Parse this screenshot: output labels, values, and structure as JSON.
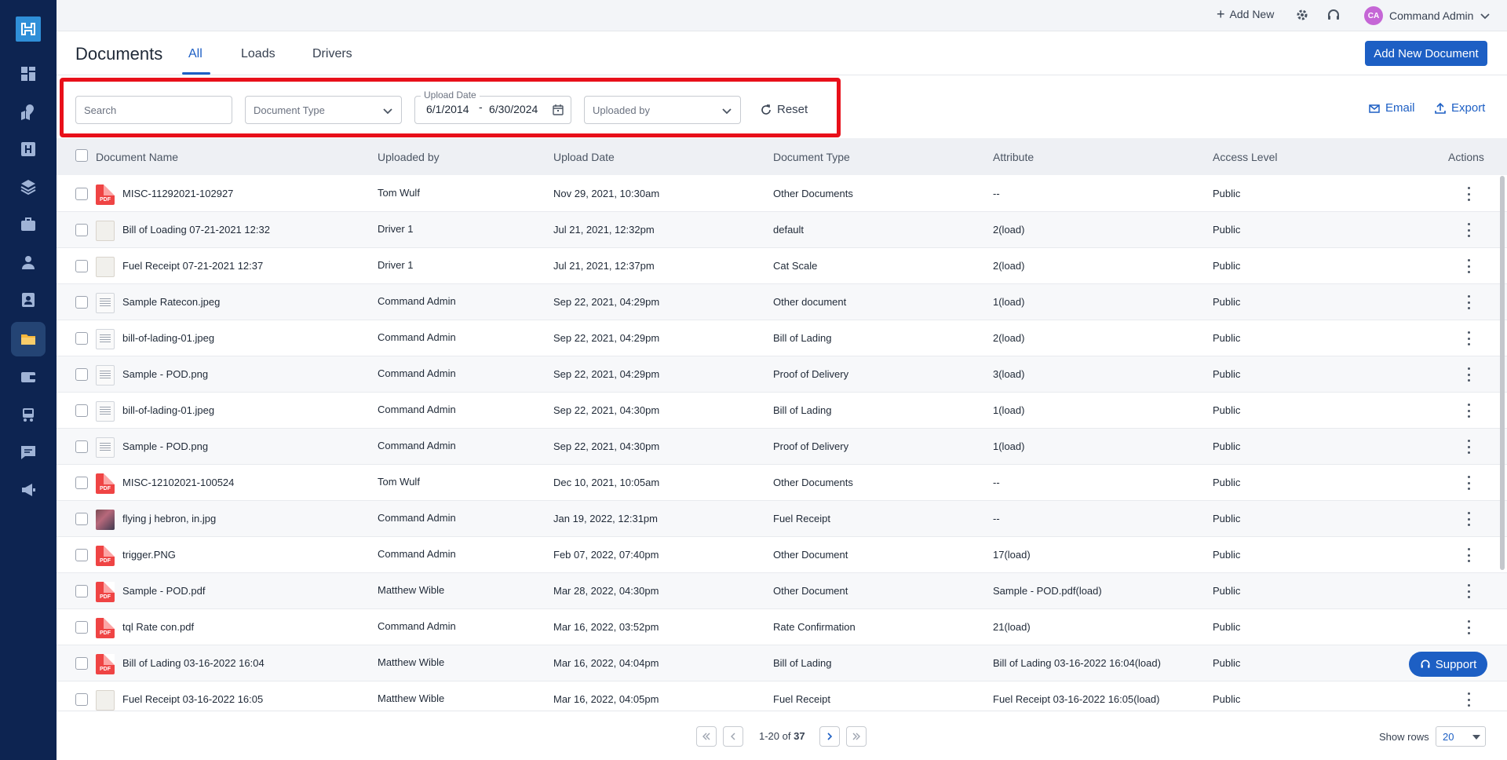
{
  "topbar": {
    "add_new": "Add New",
    "user_initials": "CA",
    "user_name": "Command Admin"
  },
  "header": {
    "title": "Documents",
    "tabs": [
      {
        "label": "All"
      },
      {
        "label": "Loads"
      },
      {
        "label": "Drivers"
      }
    ],
    "add_button": "Add New Document"
  },
  "filters": {
    "search_placeholder": "Search",
    "document_type_placeholder": "Document Type",
    "upload_date_label": "Upload Date",
    "date_from": "6/1/2014",
    "date_separator": "-",
    "date_to": "6/30/2024",
    "uploaded_by_placeholder": "Uploaded by",
    "reset_label": "Reset",
    "email_label": "Email",
    "export_label": "Export"
  },
  "table": {
    "columns": [
      "Document Name",
      "Uploaded by",
      "Upload Date",
      "Document Type",
      "Attribute",
      "Access Level",
      "Actions"
    ],
    "rows": [
      {
        "thumb": "pdf",
        "name": "MISC-11292021-102927",
        "uploaded_by": "Tom Wulf",
        "date": "Nov 29, 2021, 10:30am",
        "type": "Other Documents",
        "attribute": "--",
        "access": "Public"
      },
      {
        "thumb": "img",
        "name": "Bill of Loading 07-21-2021 12:32",
        "uploaded_by": "Driver 1",
        "date": "Jul 21, 2021, 12:32pm",
        "type": "default",
        "attribute": "2(load)",
        "access": "Public"
      },
      {
        "thumb": "img",
        "name": "Fuel Receipt 07-21-2021 12:37",
        "uploaded_by": "Driver 1",
        "date": "Jul 21, 2021, 12:37pm",
        "type": "Cat Scale",
        "attribute": "2(load)",
        "access": "Public"
      },
      {
        "thumb": "doc",
        "name": "Sample Ratecon.jpeg",
        "uploaded_by": "Command Admin",
        "date": "Sep 22, 2021, 04:29pm",
        "type": "Other document",
        "attribute": "1(load)",
        "access": "Public"
      },
      {
        "thumb": "doc",
        "name": "bill-of-lading-01.jpeg",
        "uploaded_by": "Command Admin",
        "date": "Sep 22, 2021, 04:29pm",
        "type": "Bill of Lading",
        "attribute": "2(load)",
        "access": "Public"
      },
      {
        "thumb": "doc",
        "name": "Sample - POD.png",
        "uploaded_by": "Command Admin",
        "date": "Sep 22, 2021, 04:29pm",
        "type": "Proof of Delivery",
        "attribute": "3(load)",
        "access": "Public"
      },
      {
        "thumb": "doc",
        "name": "bill-of-lading-01.jpeg",
        "uploaded_by": "Command Admin",
        "date": "Sep 22, 2021, 04:30pm",
        "type": "Bill of Lading",
        "attribute": "1(load)",
        "access": "Public"
      },
      {
        "thumb": "doc",
        "name": "Sample - POD.png",
        "uploaded_by": "Command Admin",
        "date": "Sep 22, 2021, 04:30pm",
        "type": "Proof of Delivery",
        "attribute": "1(load)",
        "access": "Public"
      },
      {
        "thumb": "pdf",
        "name": "MISC-12102021-100524",
        "uploaded_by": "Tom Wulf",
        "date": "Dec 10, 2021, 10:05am",
        "type": "Other Documents",
        "attribute": "--",
        "access": "Public"
      },
      {
        "thumb": "photo",
        "name": "flying j hebron, in.jpg",
        "uploaded_by": "Command Admin",
        "date": "Jan 19, 2022, 12:31pm",
        "type": "Fuel Receipt",
        "attribute": "--",
        "access": "Public"
      },
      {
        "thumb": "pdf",
        "name": "trigger.PNG",
        "uploaded_by": "Command Admin",
        "date": "Feb 07, 2022, 07:40pm",
        "type": "Other Document",
        "attribute": "17(load)",
        "access": "Public"
      },
      {
        "thumb": "pdf",
        "name": "Sample - POD.pdf",
        "uploaded_by": "Matthew Wible",
        "date": "Mar 28, 2022, 04:30pm",
        "type": "Other Document",
        "attribute": "Sample - POD.pdf(load)",
        "access": "Public"
      },
      {
        "thumb": "pdf",
        "name": "tql Rate con.pdf",
        "uploaded_by": "Command Admin",
        "date": "Mar 16, 2022, 03:52pm",
        "type": "Rate Confirmation",
        "attribute": "21(load)",
        "access": "Public"
      },
      {
        "thumb": "pdf",
        "name": "Bill of Lading 03-16-2022 16:04",
        "uploaded_by": "Matthew Wible",
        "date": "Mar 16, 2022, 04:04pm",
        "type": "Bill of Lading",
        "attribute": "Bill of Lading 03-16-2022 16:04(load)",
        "access": "Public"
      },
      {
        "thumb": "img",
        "name": "Fuel Receipt 03-16-2022 16:05",
        "uploaded_by": "Matthew Wible",
        "date": "Mar 16, 2022, 04:05pm",
        "type": "Fuel Receipt",
        "attribute": "Fuel Receipt 03-16-2022 16:05(load)",
        "access": "Public"
      }
    ]
  },
  "support_label": "Support",
  "pagination": {
    "range": "1-20 of ",
    "total": "37",
    "show_rows_label": "Show rows",
    "rows_value": "20"
  },
  "pdf_label": "PDF",
  "colors": {
    "sidebar": "#0d2451",
    "accent": "#1d5fc4",
    "highlight": "#e8101a"
  }
}
